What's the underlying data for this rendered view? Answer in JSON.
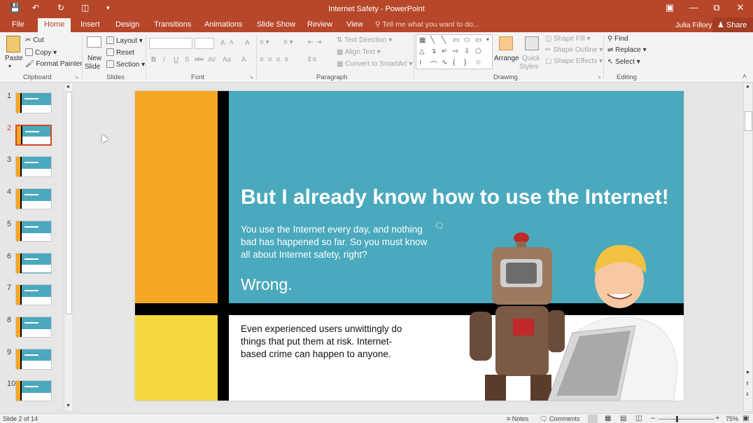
{
  "titlebar": {
    "title": "Internet Safety - PowerPoint",
    "save_icon": "save-icon",
    "undo_icon": "undo-icon",
    "redo_icon": "repeat-icon",
    "present_icon": "present-icon"
  },
  "tabs": [
    "File",
    "Home",
    "Insert",
    "Design",
    "Transitions",
    "Animations",
    "Slide Show",
    "Review",
    "View"
  ],
  "tellme": "Tell me what you want to do...",
  "user": "Julia Fillory",
  "share": "Share",
  "ribbon": {
    "clipboard": {
      "paste": "Paste",
      "cut": "Cut",
      "copy": "Copy",
      "format_painter": "Format Painter",
      "label": "Clipboard"
    },
    "slides": {
      "new_slide_1": "New",
      "new_slide_2": "Slide",
      "layout": "Layout",
      "reset": "Reset",
      "section": "Section",
      "label": "Slides"
    },
    "font": {
      "bold": "B",
      "italic": "I",
      "underline": "U",
      "shadow": "S",
      "strike": "abc",
      "spacing": "AV",
      "case": "Aa",
      "color": "A",
      "grow": "A",
      "shrink": "A",
      "clear": "A",
      "label": "Font"
    },
    "paragraph": {
      "text_direction": "Text Direction",
      "align_text": "Align Text",
      "smartart": "Convert to SmartArt",
      "label": "Paragraph"
    },
    "drawing": {
      "arrange": "Arrange",
      "quick_1": "Quick",
      "quick_2": "Styles",
      "shape_fill": "Shape Fill",
      "shape_outline": "Shape Outline",
      "shape_effects": "Shape Effects",
      "label": "Drawing"
    },
    "editing": {
      "find": "Find",
      "replace": "Replace",
      "select": "Select",
      "label": "Editing"
    }
  },
  "thumbnails": [
    "1",
    "2",
    "3",
    "4",
    "5",
    "6",
    "7",
    "8",
    "9",
    "10"
  ],
  "slide": {
    "title": "But I already know how to use the Internet!",
    "body": "You use the Internet every day, and nothing bad has happened so far. So you must know all about Internet safety, right?",
    "wrong": "Wrong.",
    "bottom": "Even experienced users unwittingly do things that put them at risk. Internet-based crime can happen to anyone.",
    "colors": {
      "teal": "#4aa9bd",
      "orange": "#f5a623",
      "yellow": "#f4d63e",
      "black": "#000000"
    }
  },
  "status": {
    "slide_count": "Slide 2 of 14",
    "notes": "Notes",
    "comments": "Comments",
    "zoom": "75%"
  }
}
